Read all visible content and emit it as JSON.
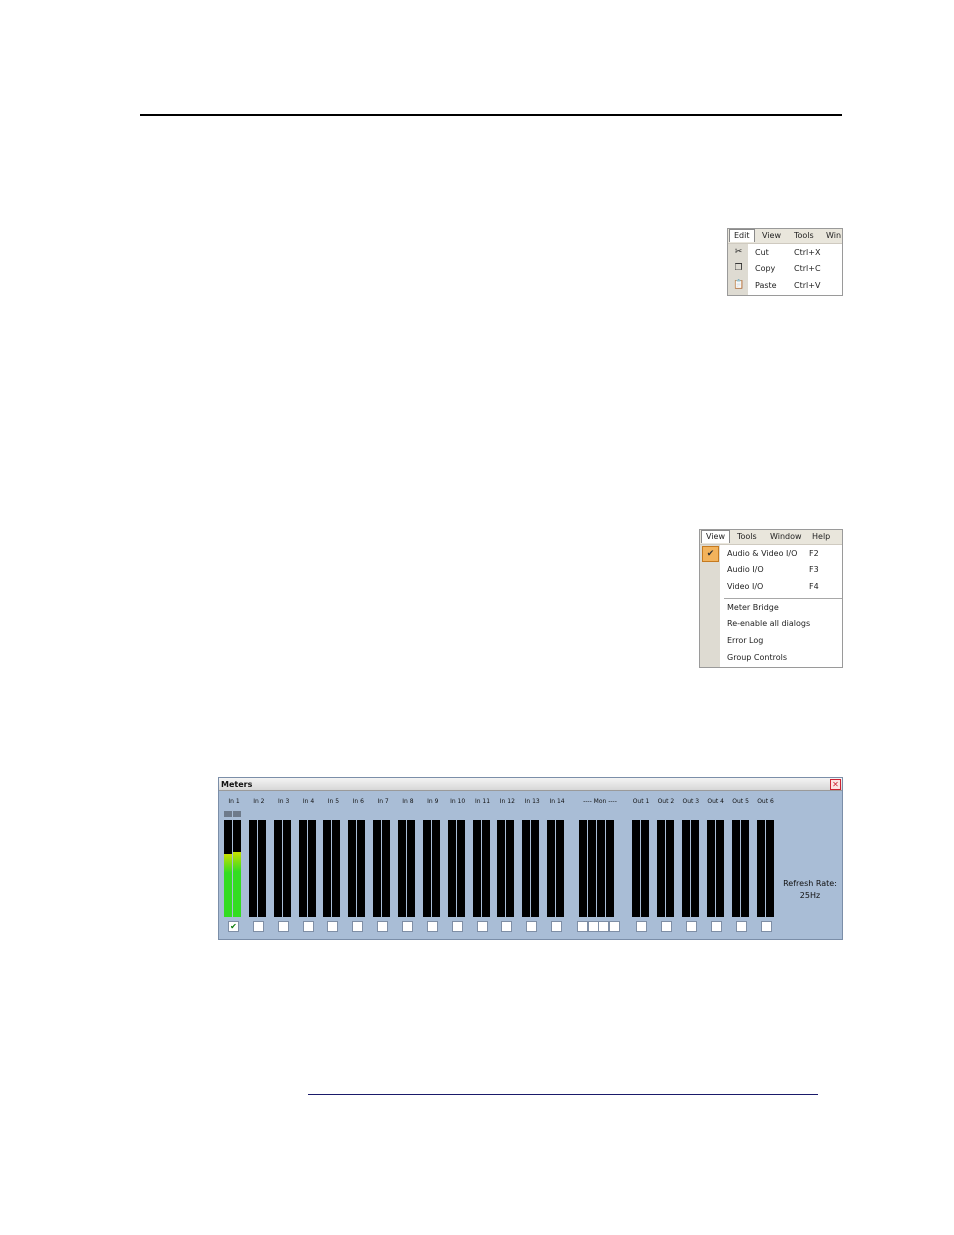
{
  "edit_menu": {
    "menubar": [
      "Edit",
      "View",
      "Tools",
      "Win"
    ],
    "items": [
      {
        "label": "Cut",
        "shortcut": "Ctrl+X",
        "icon": "scissors-icon"
      },
      {
        "label": "Copy",
        "shortcut": "Ctrl+C",
        "icon": "copy-icon"
      },
      {
        "label": "Paste",
        "shortcut": "Ctrl+V",
        "icon": "paste-icon"
      }
    ]
  },
  "view_menu": {
    "menubar": [
      "View",
      "Tools",
      "Window",
      "Help"
    ],
    "items": [
      {
        "label": "Audio & Video I/O",
        "shortcut": "F2",
        "checked": true
      },
      {
        "label": "Audio I/O",
        "shortcut": "F3"
      },
      {
        "label": "Video I/O",
        "shortcut": "F4"
      },
      {
        "label": "Meter Bridge",
        "shortcut": ""
      },
      {
        "label": "Re-enable all dialogs",
        "shortcut": ""
      },
      {
        "label": "Error Log",
        "shortcut": ""
      },
      {
        "label": "Group Controls",
        "shortcut": ""
      }
    ]
  },
  "meters": {
    "title": "Meters",
    "close_glyph": "✕",
    "channels": [
      "In 1",
      "In 2",
      "In 3",
      "In 4",
      "In 5",
      "In 6",
      "In 7",
      "In 8",
      "In 9",
      "In 10",
      "In 11",
      "In 12",
      "In 13",
      "In 14"
    ],
    "mon_label": "---- Mon ----",
    "outputs": [
      "Out 1",
      "Out 2",
      "Out 3",
      "Out 4",
      "Out 5",
      "Out 6"
    ],
    "refresh_label": "Refresh Rate:",
    "refresh_value": "25Hz",
    "in1_checked": true,
    "in1_levels": [
      0.65,
      0.67
    ],
    "colors": {
      "panel": "#a9bdd6",
      "meter_green": "#33dd22",
      "meter_yellow": "#c8e000"
    }
  }
}
